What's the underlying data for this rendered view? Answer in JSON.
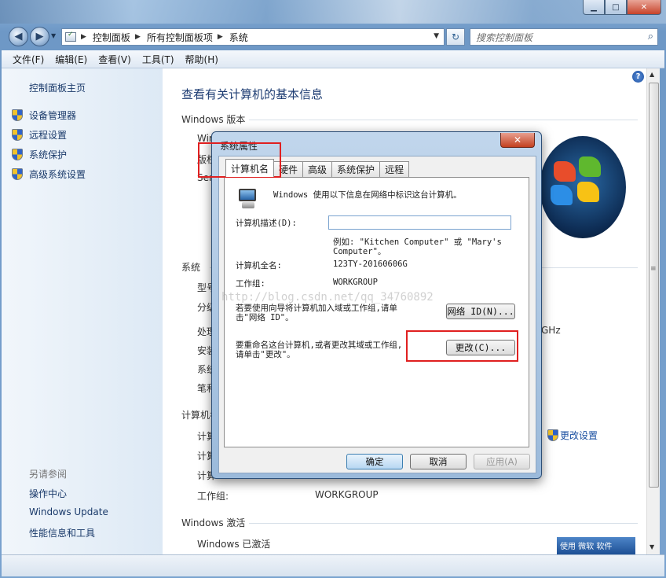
{
  "window": {
    "minimize": "▁",
    "maximize": "□",
    "close": "✕"
  },
  "nav": {
    "back": "◀",
    "forward": "▶",
    "recent": "▼",
    "breadcrumbs": [
      "控制面板",
      "所有控制面板项",
      "系统"
    ],
    "breadcrumb_sep": "▶",
    "address_dropdown": "▼",
    "refresh": "↻",
    "search_placeholder": "搜索控制面板"
  },
  "menu": [
    "文件(F)",
    "编辑(E)",
    "查看(V)",
    "工具(T)",
    "帮助(H)"
  ],
  "left_pane": {
    "home": "控制面板主页",
    "tasks": [
      "设备管理器",
      "远程设置",
      "系统保护",
      "高级系统设置"
    ],
    "see_also_title": "另请参阅",
    "see_also": [
      "操作中心",
      "Windows Update",
      "性能信息和工具"
    ]
  },
  "content": {
    "title": "查看有关计算机的基本信息",
    "section_edition": "Windows 版本",
    "edition_rows": [
      "Win",
      "版权",
      "Ser"
    ],
    "section_system": "系统",
    "system_rows": [
      "型号",
      "分级",
      "处理",
      "安装",
      "系统",
      "笔和"
    ],
    "cpu_suffix": "GHz",
    "section_computer": "计算机名",
    "computer_rows": [
      "计算",
      "计算",
      "计算"
    ],
    "workgroup_label": "工作组:",
    "workgroup_value": "WORKGROUP",
    "change_settings": "更改设置",
    "section_activation": "Windows 激活",
    "activation_status": "Windows 已激活",
    "genuine_badge": "使用 微软 软件"
  },
  "dialog": {
    "title": "系统属性",
    "close": "✕",
    "tabs": [
      "计算机名",
      "硬件",
      "高级",
      "系统保护",
      "远程"
    ],
    "intro": "Windows 使用以下信息在网络中标识这台计算机。",
    "desc_label": "计算机描述(D):",
    "desc_value": "",
    "example_line1": "例如: \"Kitchen Computer\" 或 \"Mary's",
    "example_line2": "Computer\"。",
    "fullname_label": "计算机全名:",
    "fullname_value": "123TY-20160606G",
    "workgroup_label": "工作组:",
    "workgroup_value": "WORKGROUP",
    "network_text1": "若要使用向导将计算机加入域或工作组,请单",
    "network_text2": "击\"网络 ID\"。",
    "network_button": "网络 ID(N)...",
    "rename_text1": "要重命名这台计算机,或者更改其域或工作组,",
    "rename_text2": "请单击\"更改\"。",
    "change_button": "更改(C)...",
    "ok": "确定",
    "cancel": "取消",
    "apply": "应用(A)"
  },
  "watermark": "http://blog.csdn.net/qq_34760892",
  "scroll": {
    "up": "▲",
    "down": "▼",
    "grip": "≡"
  },
  "help": "?",
  "colors": {
    "accent": "#1e3d73",
    "highlight": "#e02020",
    "link": "#1a4fa1"
  }
}
